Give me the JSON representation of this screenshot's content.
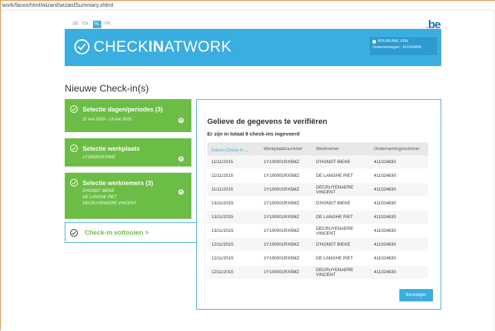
{
  "browser": {
    "url": "work/faces/html/wizard/wizardSummary.xhtml"
  },
  "languages": [
    {
      "code": "DE",
      "active": false
    },
    {
      "code": "EN",
      "active": false
    },
    {
      "code": "NL",
      "active": true
    },
    {
      "code": "FR",
      "active": false
    }
  ],
  "be_logo": {
    "text": "be",
    "dot": "."
  },
  "header": {
    "logo_part1": "CHECK",
    "logo_part2": "IN",
    "logo_part3": "AT",
    "logo_part4": "WORK",
    "user_name": "BOUWUNIE VZW",
    "company_label": "Ondernemingen : 411024830"
  },
  "page_title": "Nieuwe Check-in(s)",
  "steps": [
    {
      "title": "Selectie dagen/periodes (3)",
      "details": [
        "11 nov 2015 - 13 nov 2015"
      ]
    },
    {
      "title": "Selectie werkplaats",
      "details": [
        "1Y100001RX5MZ"
      ]
    },
    {
      "title": "Selectie werknemers  (3)",
      "details": [
        "D'HONDT BIEKE",
        "DE LANGHE PIET",
        "DECRUYENAERE VINCENT"
      ]
    }
  ],
  "final_step": {
    "label": "Check-in voltooien >"
  },
  "summary": {
    "heading": "Gelieve de gegevens te verifiëren",
    "subheading": "Er zijn in totaal 9 check-ins ingevoerd",
    "columns": [
      "Datum Check-in",
      "Werkplaatsnummer",
      "Werknemer",
      "Ondernemingsnummer"
    ],
    "sort_indicator": "︿",
    "rows": [
      [
        "11/11/2015",
        "1Y100001RX5MZ",
        "D'HONDT BIEKE",
        "411024830"
      ],
      [
        "11/11/2015",
        "1Y100001RX5MZ",
        "DE LANGHE PIET",
        "411024830"
      ],
      [
        "11/11/2015",
        "1Y100001RX5MZ",
        "DECRUYENAERE VINCENT",
        "411024830"
      ],
      [
        "13/11/2015",
        "1Y100001RX5MZ",
        "D'HONDT BIEKE",
        "411024830"
      ],
      [
        "13/11/2015",
        "1Y100001RX5MZ",
        "DE LANGHE PIET",
        "411024830"
      ],
      [
        "13/11/2015",
        "1Y100001RX5MZ",
        "DECRUYENAERE VINCENT",
        "411024830"
      ],
      [
        "12/11/2015",
        "1Y100001RX5MZ",
        "D'HONDT BIEKE",
        "411024830"
      ],
      [
        "12/11/2015",
        "1Y100001RX5MZ",
        "DE LANGHE PIET",
        "411024830"
      ],
      [
        "12/11/2015",
        "1Y100001RX5MZ",
        "DECRUYENAERE VINCENT",
        "411024830"
      ]
    ],
    "confirm_label": "Bevestigen"
  },
  "colors": {
    "accent": "#3aaee0",
    "success": "#6cbd45"
  }
}
